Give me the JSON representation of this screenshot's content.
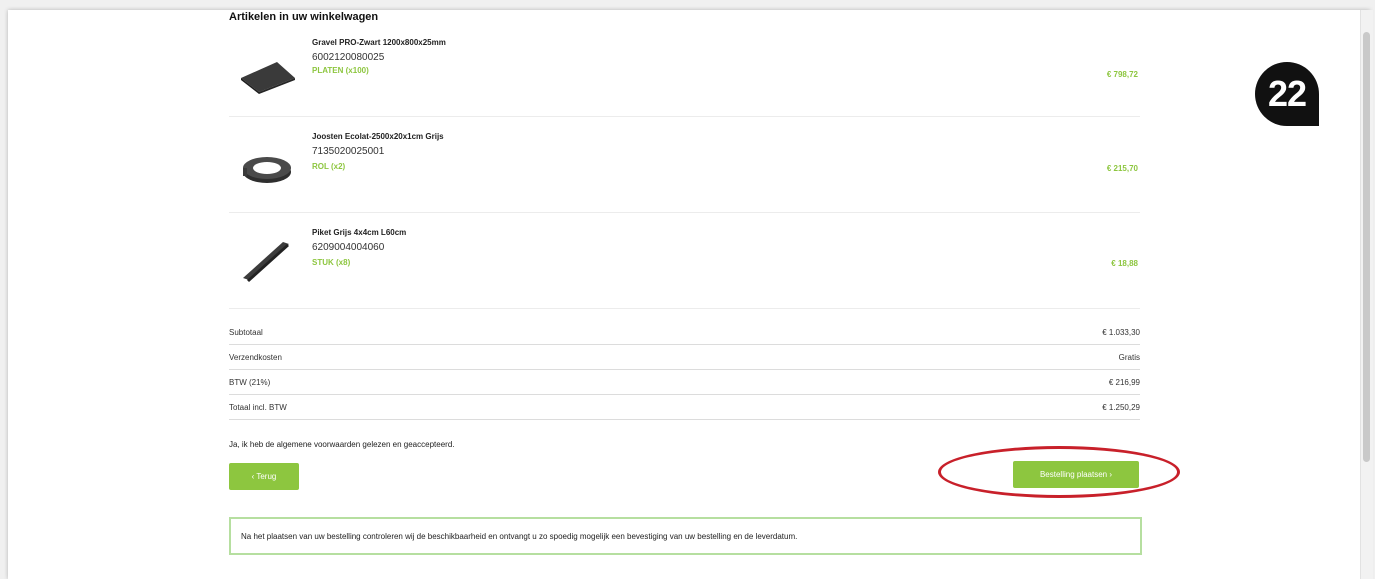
{
  "cart": {
    "title": "Artikelen in uw winkelwagen",
    "items": [
      {
        "name": "Gravel PRO-Zwart 1200x800x25mm",
        "code": "6002120080025",
        "unit": "PLATEN (x100)",
        "price": "€ 798,72",
        "icon": "gravel-plate-icon"
      },
      {
        "name": "Joosten Ecolat-2500x20x1cm Grijs",
        "code": "7135020025001",
        "unit": "ROL (x2)",
        "price": "€ 215,70",
        "icon": "edging-roll-icon"
      },
      {
        "name": "Piket Grijs 4x4cm L60cm",
        "code": "6209004004060",
        "unit": "STUK (x8)",
        "price": "€ 18,88",
        "icon": "stake-icon"
      }
    ]
  },
  "totals": {
    "subtotal": {
      "label": "Subtotaal",
      "value": "€ 1.033,30"
    },
    "shipping": {
      "label": "Verzendkosten",
      "value": "Gratis"
    },
    "vat": {
      "label": "BTW (21%)",
      "value": "€ 216,99"
    },
    "total": {
      "label": "Totaal incl. BTW",
      "value": "€ 1.250,29"
    }
  },
  "terms": {
    "text": "Ja, ik heb de algemene voorwaarden gelezen en geaccepteerd."
  },
  "buttons": {
    "back": "‹  Terug",
    "place_order": "Bestelling plaatsen  ›"
  },
  "info": {
    "text": "Na het plaatsen van uw bestelling controleren wij de beschikbaarheid en ontvangt u zo spoedig mogelijk een bevestiging van uw bestelling en de leverdatum."
  },
  "badge": {
    "number": "22"
  },
  "colors": {
    "accent_green": "#8dc63f",
    "highlight_red": "#c8202a",
    "info_border": "#b6dfa0"
  }
}
